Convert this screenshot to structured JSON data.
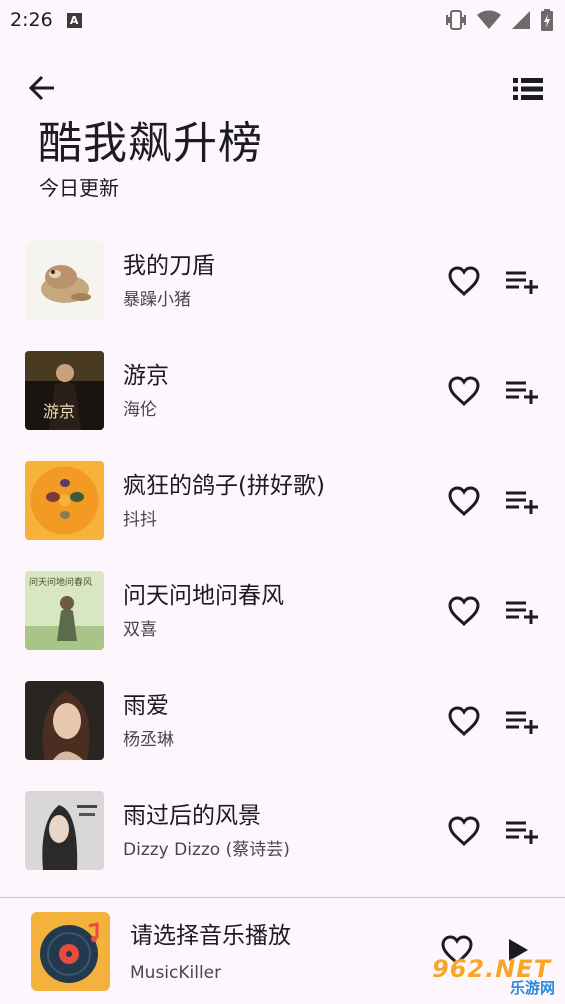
{
  "status_bar": {
    "time": "2:26",
    "notification_letter": "A"
  },
  "header": {
    "title": "酷我飙升榜",
    "subtitle": "今日更新"
  },
  "icons": {
    "back": "arrow-left-icon",
    "list": "list-view-icon",
    "favorite": "heart-outline-icon",
    "add_to_playlist": "playlist-add-icon",
    "play": "play-icon"
  },
  "songs": [
    {
      "title": "我的刀盾",
      "artist": "暴躁小猪"
    },
    {
      "title": "游京",
      "artist": "海伦"
    },
    {
      "title": "疯狂的鸽子(拼好歌)",
      "artist": "抖抖"
    },
    {
      "title": "问天问地问春风",
      "artist": "双喜"
    },
    {
      "title": "雨爱",
      "artist": "杨丞琳"
    },
    {
      "title": "雨过后的风景",
      "artist": "Dizzy Dizzo (蔡诗芸)"
    }
  ],
  "covers": {
    "c2": "游京",
    "c4": "问天问地问春风"
  },
  "player": {
    "title": "请选择音乐播放",
    "artist": "MusicKiller"
  },
  "watermark": {
    "number": "962.NET",
    "site": "乐游网"
  },
  "colors": {
    "background": "#fdf7fd",
    "text": "#1c1b1f",
    "secondary_text": "#49454f",
    "divider": "#c9c5ca"
  }
}
